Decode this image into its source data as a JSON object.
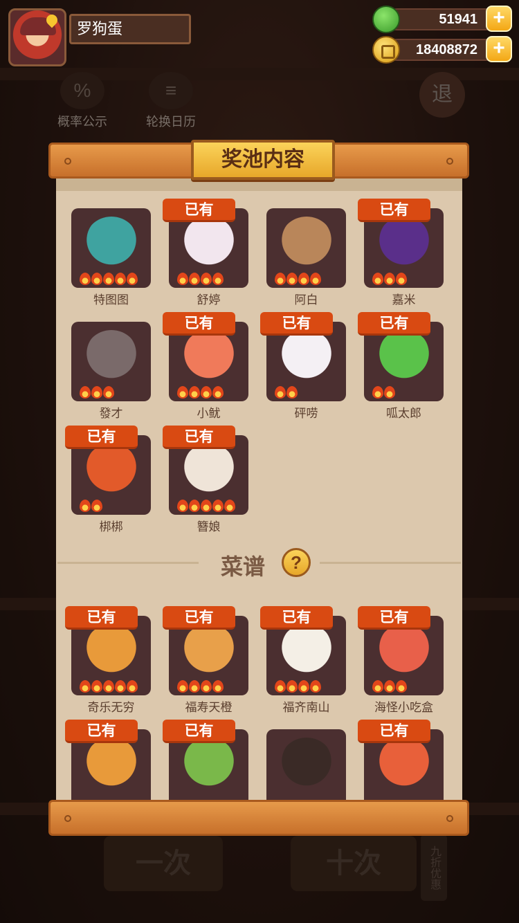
{
  "profile": {
    "name": "罗狗蛋"
  },
  "currency": {
    "apples": "51941",
    "coins": "18408872",
    "plus": "+"
  },
  "background": {
    "buttons": [
      {
        "icon": "%",
        "label": "概率公示"
      },
      {
        "icon": "≡",
        "label": "轮换日历"
      }
    ],
    "quit_label": "退",
    "bottom_buttons": [
      "一次",
      "十次"
    ],
    "discount": "九折优惠"
  },
  "panel": {
    "title": "奖池内容",
    "owned_label": "已有",
    "characters": [
      {
        "name": "特图图",
        "owned": false,
        "stars": 5,
        "color": "#3fa3a0"
      },
      {
        "name": "舒婷",
        "owned": true,
        "stars": 4,
        "color": "#f2e6ee"
      },
      {
        "name": "阿白",
        "owned": false,
        "stars": 4,
        "color": "#b9865a"
      },
      {
        "name": "嘉米",
        "owned": true,
        "stars": 3,
        "color": "#5a2f8a"
      },
      {
        "name": "發才",
        "owned": false,
        "stars": 3,
        "color": "#7a6a6a"
      },
      {
        "name": "小鱿",
        "owned": true,
        "stars": 4,
        "color": "#f07a5a"
      },
      {
        "name": "砰唠",
        "owned": true,
        "stars": 2,
        "color": "#f4f0f4"
      },
      {
        "name": "呱太郎",
        "owned": true,
        "stars": 2,
        "color": "#5ac24a"
      },
      {
        "name": "梆梆",
        "owned": true,
        "stars": 2,
        "color": "#e25a2a"
      },
      {
        "name": "簪娘",
        "owned": true,
        "stars": 5,
        "color": "#efe4d8"
      }
    ],
    "recipes_title": "菜谱",
    "help_icon": "?",
    "recipes": [
      {
        "name": "奇乐无穷",
        "owned": true,
        "stars": 5,
        "color": "#e89a3a"
      },
      {
        "name": "福寿天橙",
        "owned": true,
        "stars": 4,
        "color": "#e8a04a"
      },
      {
        "name": "福齐南山",
        "owned": true,
        "stars": 4,
        "color": "#f4efe6"
      },
      {
        "name": "海怪小吃盒",
        "owned": true,
        "stars": 3,
        "color": "#e8604a"
      },
      {
        "name": "",
        "owned": true,
        "stars": 0,
        "color": "#e89a3a"
      },
      {
        "name": "",
        "owned": true,
        "stars": 0,
        "color": "#7ab84a"
      },
      {
        "name": "",
        "owned": false,
        "stars": 0,
        "color": "#3a2a26"
      },
      {
        "name": "",
        "owned": true,
        "stars": 0,
        "color": "#e8603a"
      }
    ]
  }
}
